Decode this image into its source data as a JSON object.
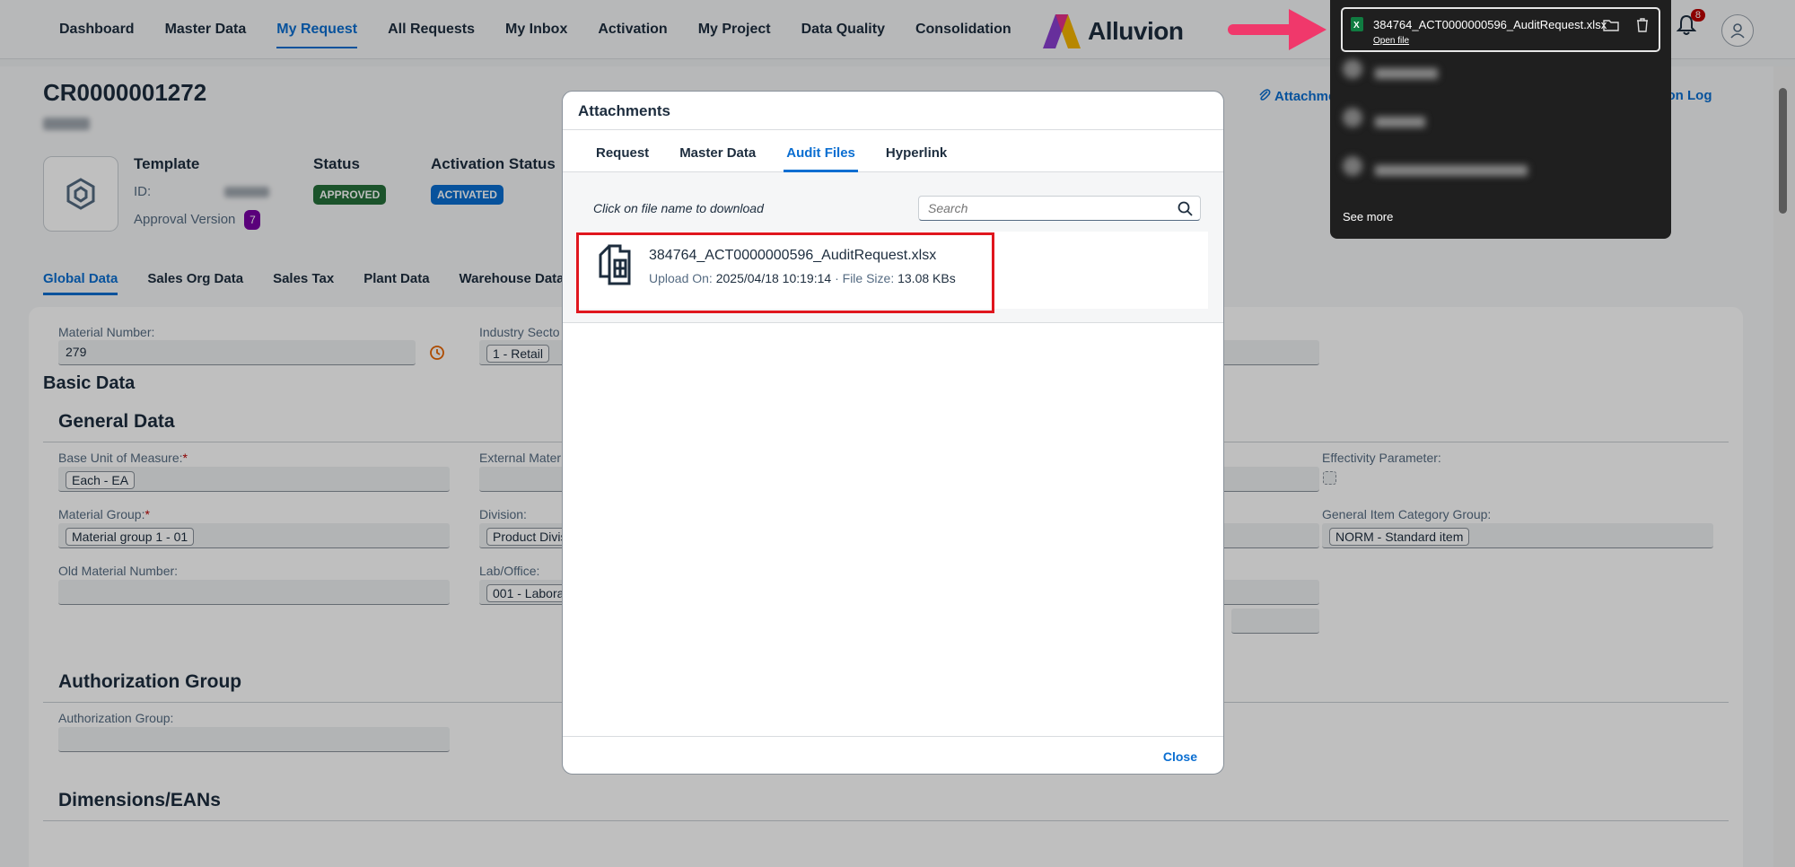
{
  "nav": {
    "items": [
      "Dashboard",
      "Master Data",
      "My Request",
      "All Requests",
      "My Inbox",
      "Activation",
      "My Project",
      "Data Quality",
      "Consolidation"
    ],
    "active": "My Request",
    "brand": "Alluvion",
    "notification_count": "8"
  },
  "header": {
    "cr_number": "CR0000001272",
    "template_label": "Template",
    "id_label": "ID:",
    "approval_label": "Approval Version",
    "approval_version": "7",
    "status_label": "Status",
    "status_value": "APPROVED",
    "activation_label": "Activation Status",
    "activation_value": "ACTIVATED",
    "attachments_link": "Attachme",
    "version_log_link": "sion Log"
  },
  "subtabs": [
    "Global Data",
    "Sales Org Data",
    "Sales Tax",
    "Plant Data",
    "Warehouse Data"
  ],
  "form": {
    "material_number_label": "Material Number:",
    "material_number_value": "279",
    "industry_sector_label": "Industry Secto",
    "industry_sector_value": "1 - Retail",
    "basic_data": "Basic Data",
    "general_data": "General Data",
    "base_uom_label": "Base Unit of Measure:",
    "base_uom_value": "Each - EA",
    "external_label": "External Mater",
    "effectivity_label": "Effectivity Parameter:",
    "material_group_label": "Material Group:",
    "material_group_value": "Material group 1 - 01",
    "division_label": "Division:",
    "division_value": "Product Divis",
    "gen_item_cat_label": "General Item Category Group:",
    "gen_item_cat_value": "NORM - Standard item",
    "old_material_label": "Old Material Number:",
    "lab_label": "Lab/Office:",
    "lab_value": "001 - Labora",
    "authorization_group": "Authorization Group",
    "authorization_group_label": "Authorization Group:",
    "dimensions": "Dimensions/EANs",
    "required_mark": "*"
  },
  "modal": {
    "title": "Attachments",
    "tabs": [
      "Request",
      "Master Data",
      "Audit Files",
      "Hyperlink"
    ],
    "active_tab": "Audit Files",
    "hint": "Click on file name to download",
    "search_placeholder": "Search",
    "file": {
      "name": "384764_ACT0000000596_AuditRequest.xlsx",
      "upload_label": "Upload On:",
      "upload_value": "2025/04/18 10:19:14",
      "separator": "·",
      "size_label": "File Size:",
      "size_value": "13.08 KBs"
    },
    "close_label": "Close"
  },
  "downloads": {
    "file_name": "384764_ACT0000000596_AuditRequest.xlsx",
    "open_label": "Open file",
    "see_more": "See more"
  },
  "colors": {
    "accent": "#0a6ed1",
    "approved": "#256f3a",
    "highlight": "#e0161e",
    "arrow": "#f0386b"
  }
}
